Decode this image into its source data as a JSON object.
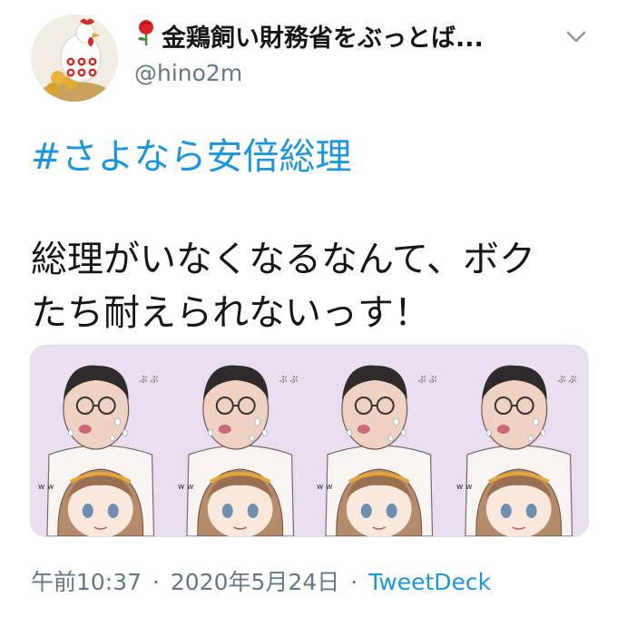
{
  "author": {
    "display_name": "金鶏飼い財務省をぶっとば...",
    "handle": "@hino2m",
    "avatar_icon": "rooster-avatar-icon",
    "rose_emoji_icon": "rose-icon",
    "pig_emoji_icon": "pig-nose-icon"
  },
  "tweet": {
    "hashtag": "#さよなら安倍総理",
    "line1": "総理がいなくなるなんて、ボク",
    "line2": "たち耐えられないっす！"
  },
  "media": {
    "panel_count": 4,
    "side_text_left": "w w",
    "side_text_right": "ぷ ぷ"
  },
  "meta": {
    "time": "午前10:37",
    "date": "2020年5月24日",
    "separator": "·",
    "source": "TweetDeck"
  },
  "colors": {
    "link": "#1b95e0",
    "muted": "#657786",
    "text": "#14171a"
  }
}
